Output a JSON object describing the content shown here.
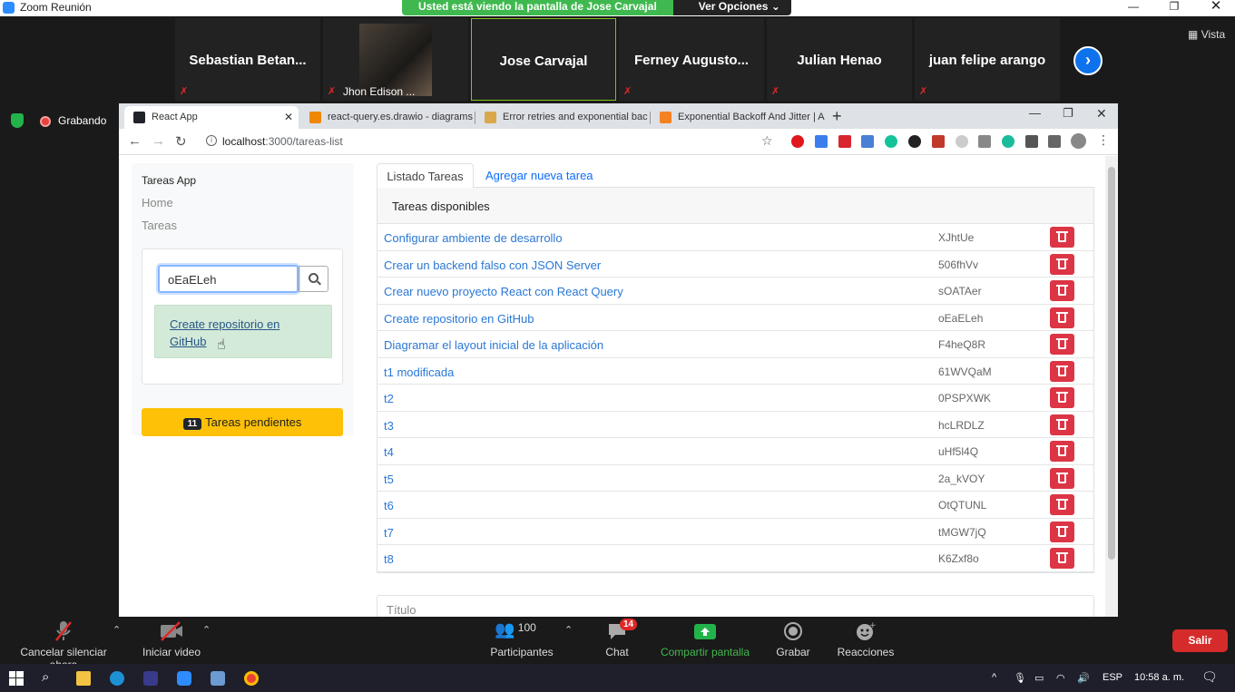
{
  "zoom": {
    "window_title": "Zoom Reunión",
    "share_banner": "Usted está viendo la pantalla de Jose Carvajal",
    "view_options": "Ver Opciones",
    "vista": "Vista",
    "recording": "Grabando",
    "participants": [
      {
        "name": "Sebastian  Betan..."
      },
      {
        "name": "Jhon Edison ..."
      },
      {
        "name": "Jose Carvajal"
      },
      {
        "name": "Ferney  Augusto..."
      },
      {
        "name": "Julian Henao"
      },
      {
        "name": "juan felipe arango"
      }
    ],
    "toolbar": {
      "unmute": "Cancelar silenciar ahora",
      "start_video": "Iniciar video",
      "participants_label": "Participantes",
      "participants_count": "100",
      "chat": "Chat",
      "chat_badge": "14",
      "share": "Compartir pantalla",
      "record": "Grabar",
      "reactions": "Reacciones",
      "leave": "Salir"
    },
    "colors": {
      "share_green": "#3fb94f",
      "leave_red": "#d62b2b",
      "zoom_blue": "#0e72ed"
    }
  },
  "browser": {
    "tabs": [
      {
        "title": "React App",
        "active": true
      },
      {
        "title": "react-query.es.drawio - diagrams"
      },
      {
        "title": "Error retries and exponential bac"
      },
      {
        "title": "Exponential Backoff And Jitter | A"
      }
    ],
    "url_host": "localhost",
    "url_rest": ":3000/tareas-list"
  },
  "app": {
    "brand": "Tareas App",
    "nav": [
      "Home",
      "Tareas"
    ],
    "search_value": "oEaELeh",
    "search_result": "Create repositorio en GitHub",
    "pending_count": "11",
    "pending_label": "Tareas pendientes",
    "tab_list": "Listado Tareas",
    "tab_add": "Agregar nueva tarea",
    "card_header": "Tareas disponibles",
    "title_placeholder": "Título",
    "tasks": [
      {
        "name": "Configurar ambiente de desarrollo",
        "id": "XJhtUe"
      },
      {
        "name": "Crear un backend falso con JSON Server",
        "id": "506fhVv"
      },
      {
        "name": "Crear nuevo proyecto React con React Query",
        "id": "sOATAer"
      },
      {
        "name": "Create repositorio en GitHub",
        "id": "oEaELeh"
      },
      {
        "name": "Diagramar el layout inicial de la aplicación",
        "id": "F4heQ8R"
      },
      {
        "name": "t1 modificada",
        "id": "61WVQaM"
      },
      {
        "name": "t2",
        "id": "0PSPXWK"
      },
      {
        "name": "t3",
        "id": "hcLRDLZ"
      },
      {
        "name": "t4",
        "id": "uHf5l4Q"
      },
      {
        "name": "t5",
        "id": "2a_kVOY"
      },
      {
        "name": "t6",
        "id": "OtQTUNL"
      },
      {
        "name": "t7",
        "id": "tMGW7jQ"
      },
      {
        "name": "t8",
        "id": "K6Zxf8o"
      }
    ]
  },
  "taskbar": {
    "language": "ESP",
    "time": "10:58 a. m."
  }
}
